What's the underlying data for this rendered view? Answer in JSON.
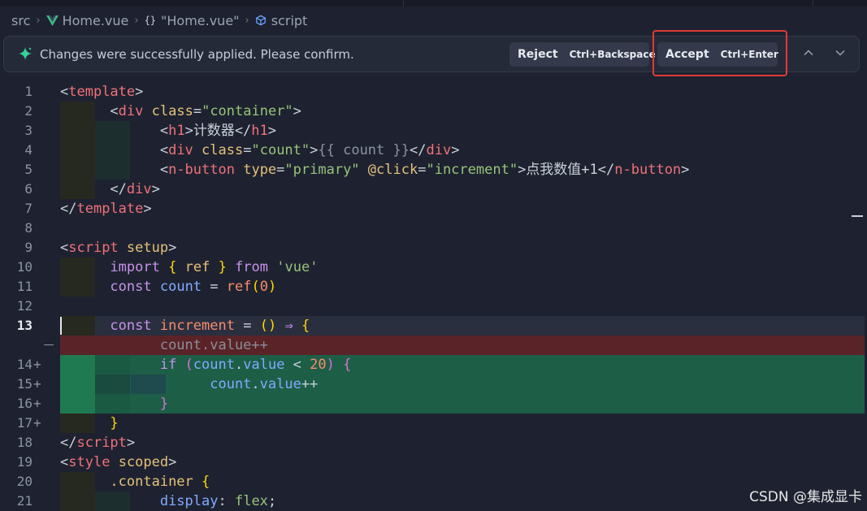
{
  "breadcrumb": {
    "items": [
      "src",
      "Home.vue",
      "\"Home.vue\"",
      "script"
    ],
    "icons": [
      "vue-icon",
      "braces-icon",
      "cube-icon"
    ]
  },
  "notification": {
    "icon": "sparkle-icon",
    "message": "Changes were successfully applied. Please confirm.",
    "reject": {
      "label": "Reject",
      "shortcut": "Ctrl+Backspace"
    },
    "accept": {
      "label": "Accept",
      "shortcut": "Ctrl+Enter"
    },
    "nav_icons": [
      "chevron-up-icon",
      "chevron-down-icon"
    ]
  },
  "editor": {
    "active_line": "13",
    "line_numbers": {
      "l1": "1",
      "l2": "2",
      "l3": "3",
      "l4": "4",
      "l5": "5",
      "l6": "6",
      "l7": "7",
      "l8": "8",
      "l9": "9",
      "l10": "10",
      "l11": "11",
      "l12": "12",
      "l13": "13",
      "l14": "14",
      "l15": "15",
      "l16": "16",
      "l17": "17",
      "l18": "18",
      "l19": "19",
      "l20": "20",
      "l21": "21"
    },
    "diff_marker_add": "+",
    "text": {
      "t1": "计数器",
      "t2": "点我数值+1",
      "t3": "count.value++"
    },
    "colors": {
      "added_line": "#1d5e47",
      "removed_line": "#5a2328",
      "highlight_box": "#e03a35"
    }
  },
  "watermark": "CSDN @集成显卡"
}
